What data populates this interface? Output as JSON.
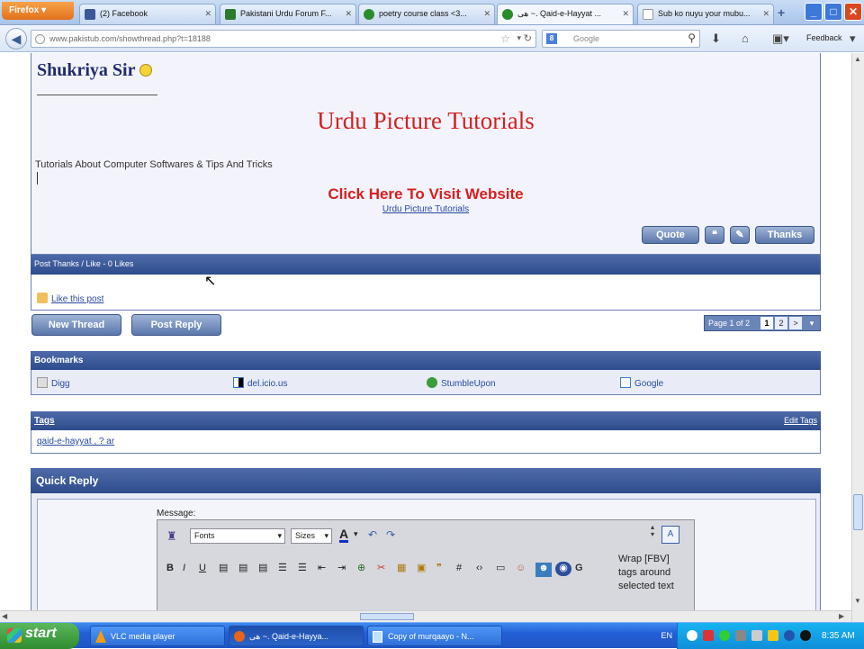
{
  "browser": {
    "app_button": "Firefox",
    "tabs": [
      {
        "label": "(2) Facebook",
        "icon": "facebook-icon",
        "color": "#3b5998"
      },
      {
        "label": "Pakistani Urdu Forum F...",
        "icon": "forum-icon",
        "color": "#2c7a2c"
      },
      {
        "label": "poetry course class <3...",
        "icon": "globe-icon",
        "color": "#2a8c2a"
      },
      {
        "label": "ھی ~. Qaid-e-Hayyat ...",
        "icon": "globe-icon",
        "color": "#2a8c2a"
      },
      {
        "label": "Sub ko nuyu your mubu...",
        "icon": "page-icon",
        "color": "#bbbbbb"
      }
    ],
    "url": "www.pakistub.com/showthread.php?t=18188",
    "search_engine": "Google",
    "bookmarks_label": "Feedback"
  },
  "post": {
    "greeting": "Shukriya Sir",
    "banner_title": "Urdu Picture Tutorials",
    "description": "Tutorials About Computer Softwares & Tips And Tricks",
    "cta": "Click Here To Visit Website",
    "cta_link": "Urdu Picture Tutorials",
    "buttons": {
      "quote": "Quote",
      "thanks": "Thanks"
    }
  },
  "thanks_bar": {
    "label": "Post Thanks / Like - 0 Likes"
  },
  "like_link": "Like this post",
  "thread_buttons": {
    "new_thread": "New Thread",
    "post_reply": "Post Reply"
  },
  "pagination": {
    "label": "Page 1 of 2",
    "pages": [
      "1",
      "2"
    ],
    "next": ">"
  },
  "bookmarks": {
    "title": "Bookmarks",
    "items": [
      {
        "label": "Digg",
        "icon": "digg-icon"
      },
      {
        "label": "del.icio.us",
        "icon": "delicious-icon"
      },
      {
        "label": "StumbleUpon",
        "icon": "stumbleupon-icon"
      },
      {
        "label": "Google",
        "icon": "google-icon"
      }
    ]
  },
  "tags": {
    "title": "Tags",
    "edit": "Edit Tags",
    "values": "qaid-e-hayyat , ? ar"
  },
  "quick_reply": {
    "title": "Quick Reply",
    "message_label": "Message:",
    "font_select": "Fonts",
    "size_select": "Sizes",
    "wrap_text": "Wrap [FBV] tags around selected text"
  },
  "taskbar": {
    "start": "start",
    "items": [
      "VLC media player",
      "ھی ~. Qaid-e-Hayya...",
      "Copy of murqaayo - N..."
    ],
    "lang": "EN",
    "time": "8:35 AM"
  }
}
